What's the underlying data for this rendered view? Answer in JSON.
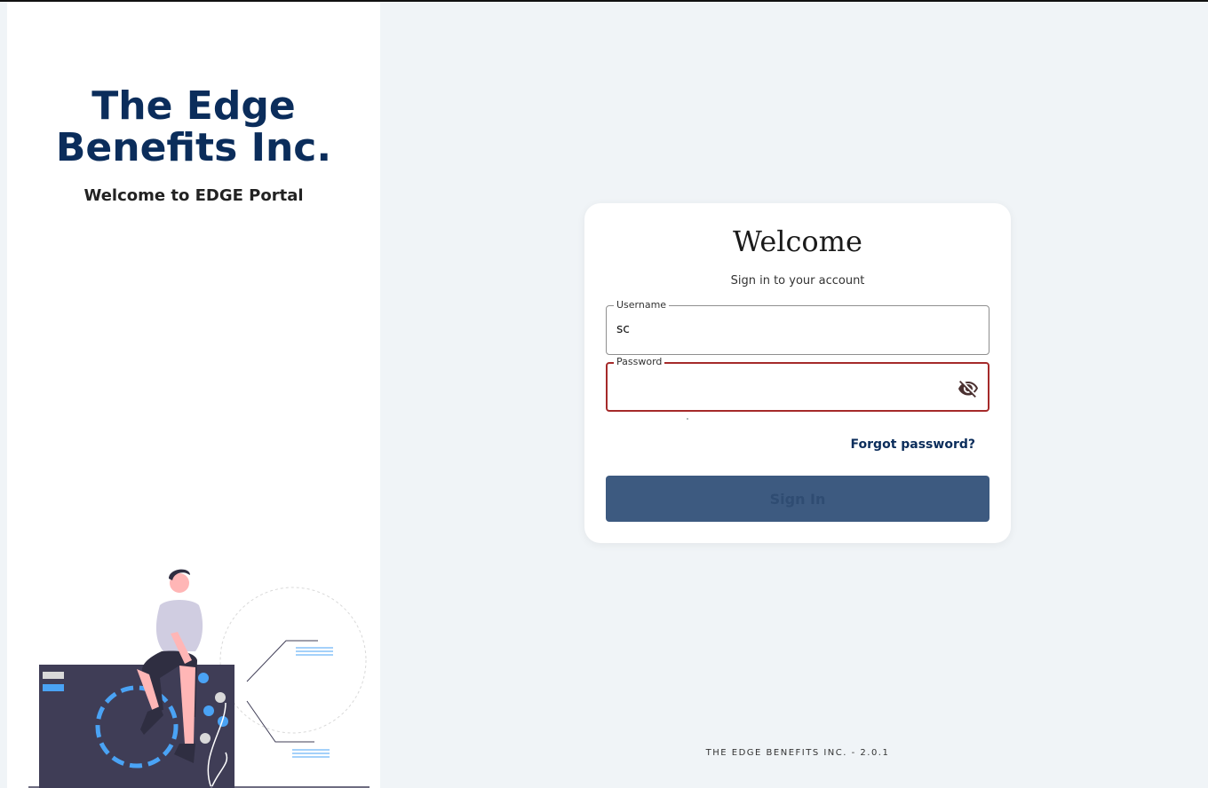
{
  "brand": {
    "title": "The Edge Benefits Inc.",
    "subtitle": "Welcome to EDGE Portal"
  },
  "login": {
    "title": "Welcome",
    "subtitle": "Sign in to your account",
    "username_label": "Username",
    "username_value": "sc",
    "password_label": "Password",
    "password_value": "",
    "password_toggle_icon": "eye-off-icon",
    "forgot_password": "Forgot password?",
    "sign_in": "Sign In"
  },
  "footer": {
    "text": "THE EDGE BENEFITS INC. - 2.0.1"
  },
  "colors": {
    "brand_navy": "#0b2d5b",
    "button": "#3d5a80",
    "error_border": "#a52a2a",
    "background": "#f0f4f7"
  }
}
